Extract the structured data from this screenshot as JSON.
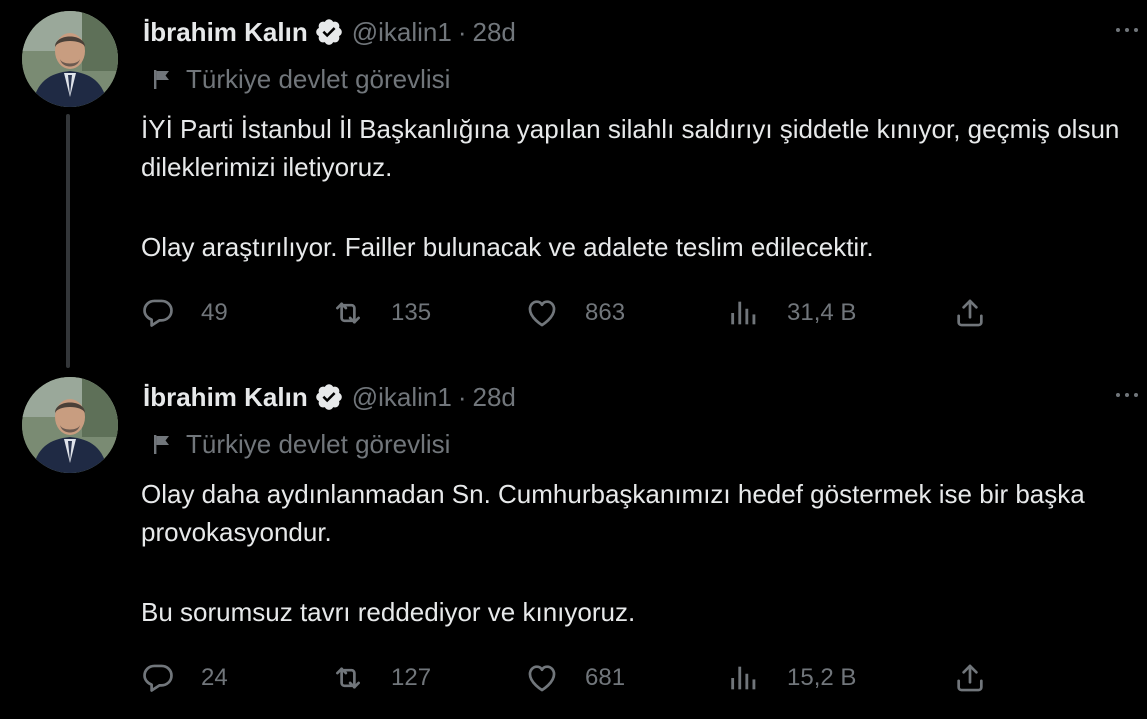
{
  "tweets": [
    {
      "author": {
        "name": "İbrahim Kalın",
        "handle": "@ikalin1"
      },
      "time": "28d",
      "separator": "·",
      "label": "Türkiye devlet görevlisi",
      "text": [
        "İYİ Parti İstanbul İl Başkanlığına yapılan silahlı saldırıyı şiddetle kınıyor, geçmiş olsun dileklerimizi iletiyoruz.",
        "Olay araştırılıyor. Failler bulunacak ve adalete teslim edilecektir."
      ],
      "stats": {
        "replies": "49",
        "retweets": "135",
        "likes": "863",
        "views": "31,4 B"
      }
    },
    {
      "author": {
        "name": "İbrahim Kalın",
        "handle": "@ikalin1"
      },
      "time": "28d",
      "separator": "·",
      "label": "Türkiye devlet görevlisi",
      "text": [
        "Olay daha aydınlanmadan Sn. Cumhurbaşkanımızı hedef göstermek ise bir başka provokasyondur.",
        "Bu sorumsuz tavrı reddediyor ve kınıyoruz."
      ],
      "stats": {
        "replies": "24",
        "retweets": "127",
        "likes": "681",
        "views": "15,2 B"
      }
    }
  ],
  "icons": {
    "verified": "verified-badge-icon",
    "flag": "flag-icon",
    "more": "more-icon",
    "reply": "reply-icon",
    "retweet": "retweet-icon",
    "like": "heart-icon",
    "views": "views-icon",
    "share": "share-icon"
  },
  "colors": {
    "background": "#000000",
    "text_primary": "#e7e9ea",
    "text_secondary": "#71767b",
    "verified": "#e7e9ea",
    "thread_line": "#333639"
  }
}
